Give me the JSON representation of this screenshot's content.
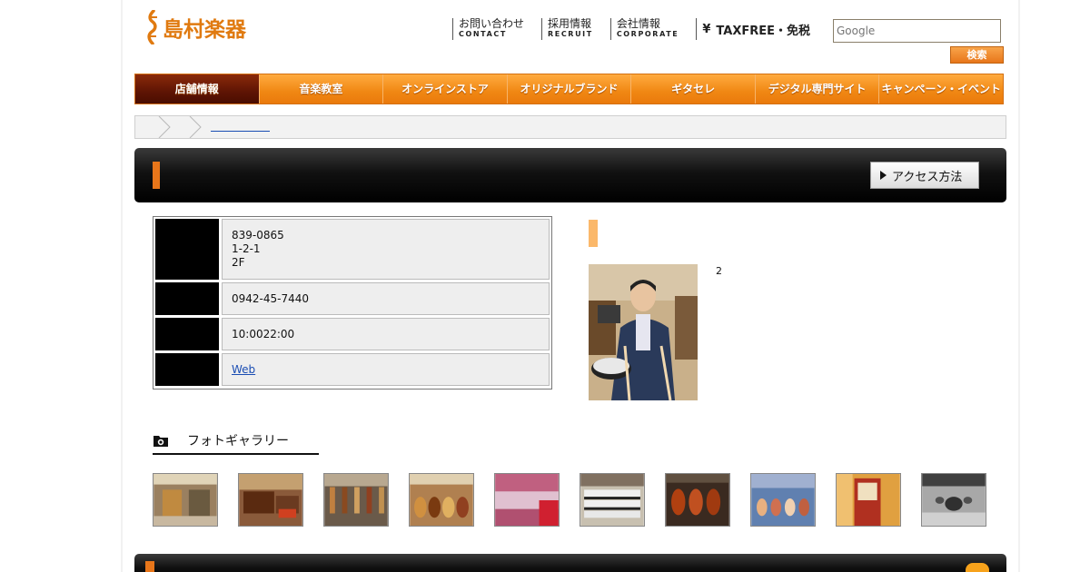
{
  "header": {
    "logo_text": "島村楽器",
    "links": [
      {
        "jp": "お問い合わせ",
        "en": "CONTACT"
      },
      {
        "jp": "採用情報",
        "en": "RECRUIT"
      },
      {
        "jp": "会社情報",
        "en": "CORPORATE"
      }
    ],
    "taxfree_symbol": "¥",
    "taxfree_label": "TAXFREE・免税",
    "search_placeholder": "Google",
    "search_button": "検索"
  },
  "nav": [
    {
      "label": "店舗情報",
      "active": true
    },
    {
      "label": "音楽教室"
    },
    {
      "label": "オンラインストア"
    },
    {
      "label": "オリジナルブランド"
    },
    {
      "label": "ギタセレ"
    },
    {
      "label": "デジタル専門サイト"
    },
    {
      "label": "キャンペーン・イベント"
    }
  ],
  "title_bar": {
    "access_button": "アクセス方法"
  },
  "info": {
    "address_lines": [
      "839-0865",
      "1-2-1",
      "2F"
    ],
    "phone": "0942-45-7440",
    "hours": "10:0022:00",
    "web_link": "Web"
  },
  "staff": {
    "text": "2"
  },
  "gallery": {
    "title": "フォトギャラリー"
  },
  "colors": {
    "accent": "#e8761a",
    "nav_active": "#5e1404",
    "link": "#1a4db3"
  }
}
